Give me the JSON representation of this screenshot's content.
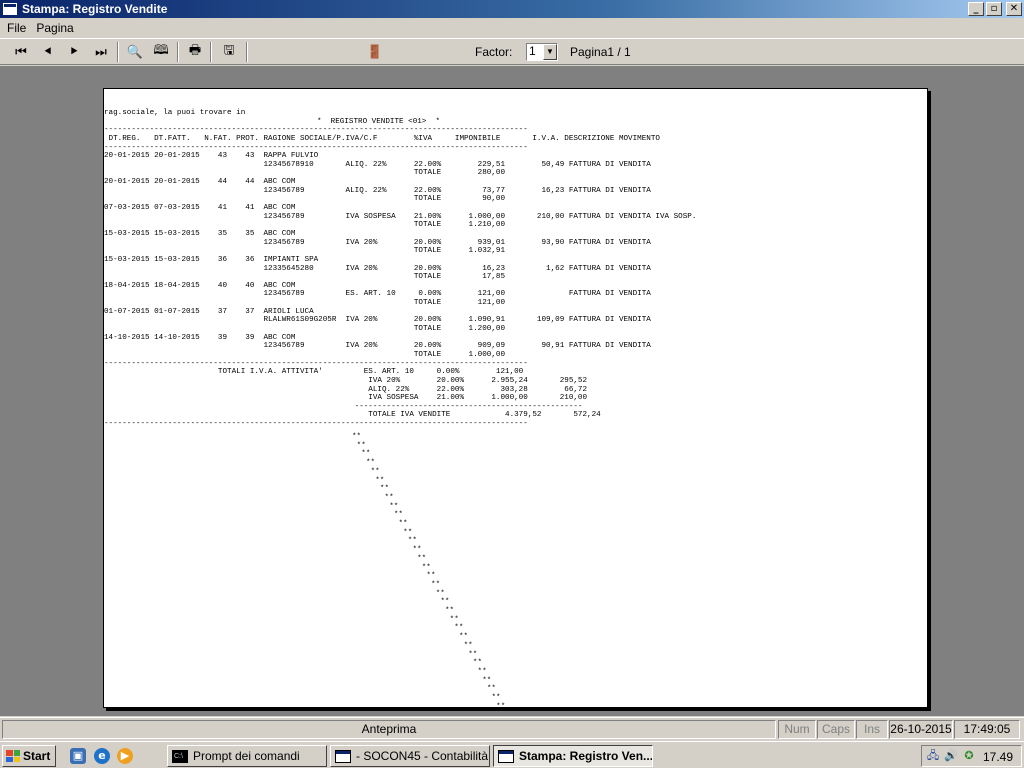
{
  "window": {
    "title": "Stampa: Registro Vendite",
    "buttons": {
      "minimize": "_",
      "maximize": "▫",
      "close": "✕"
    }
  },
  "menu": [
    {
      "label": "File"
    },
    {
      "label": "Pagina"
    }
  ],
  "toolbar": {
    "icons": [
      {
        "name": "first-page-icon",
        "glyph": "⏮"
      },
      {
        "name": "prev-page-icon",
        "glyph": "⯇"
      },
      {
        "name": "next-page-icon",
        "glyph": "⯈"
      },
      {
        "name": "last-page-icon",
        "glyph": "⏭"
      },
      {
        "name": "zoom-icon",
        "glyph": "🔍"
      },
      {
        "name": "two-pages-icon",
        "glyph": "🕮"
      },
      {
        "name": "print-icon",
        "glyph": "🖶"
      },
      {
        "name": "export-icon",
        "glyph": "🖫"
      },
      {
        "name": "exit-icon",
        "glyph": "🚪"
      }
    ],
    "factor_label": "Factor:",
    "factor_value": "1",
    "page_label": "Pagina1 / 1"
  },
  "report": {
    "header_note": "rag.sociale, la puoi trovare in",
    "title": "*  REGISTRO VENDITE <01>  *",
    "separator": "-----------------------------------------------------------------------------------------------------------",
    "short_separator": "---------------------------------------------------------------------------------------------",
    "columns": " DT.REG.   DT.FATT.   N.FAT. PROT. RAGIONE SOCIALE/P.IVA/C.F        %IVA     IMPONIBILE       I.V.A. DESCRIZIONE MOVIMENTO",
    "rows": [
      "20-01-2015 20-01-2015    43    43  RAPPA FULVIO",
      "                                   12345678910       ALIQ. 22%      22.00%        229,51        50,49 FATTURA DI VENDITA",
      "                                                                    TOTALE        280,00",
      "20-01-2015 20-01-2015    44    44  ABC COM",
      "                                   123456789         ALIQ. 22%      22.00%         73,77        16,23 FATTURA DI VENDITA",
      "                                                                    TOTALE         90,00",
      "07-03-2015 07-03-2015    41    41  ABC COM",
      "                                   123456789         IVA SOSPESA    21.00%      1.000,00       210,00 FATTURA DI VENDITA IVA SOSP.",
      "                                                                    TOTALE      1.210,00",
      "15-03-2015 15-03-2015    35    35  ABC COM",
      "                                   123456789         IVA 20%        20.00%        939,01        93,90 FATTURA DI VENDITA",
      "                                                                    TOTALE      1.032,91",
      "15-03-2015 15-03-2015    36    36  IMPIANTI SPA",
      "                                   12335645280       IVA 20%        20.00%         16,23         1,62 FATTURA DI VENDITA",
      "                                                                    TOTALE         17,85",
      "18-04-2015 18-04-2015    40    40  ABC COM",
      "                                   123456789         ES. ART. 10     0.00%        121,00              FATTURA DI VENDITA",
      "                                                                    TOTALE        121,00",
      "01-07-2015 01-07-2015    37    37  ARIOLI LUCA",
      "                                   RLALWR61S09G205R  IVA 20%        20.00%      1.090,91       109,09 FATTURA DI VENDITA",
      "                                                                    TOTALE      1.200,00",
      "14-10-2015 14-10-2015    39    39  ABC COM",
      "                                   123456789         IVA 20%        20.00%        909,09        90,91 FATTURA DI VENDITA",
      "                                                                    TOTALE      1.000,00"
    ],
    "totals": [
      "                         TOTALI I.V.A. ATTIVITA'         ES. ART. 10     0.00%        121,00",
      "                                                          IVA 20%        20.00%      2.955,24       295,52",
      "                                                          ALIQ. 22%      22.00%        303,28        66,72",
      "                                                          IVA SOSPESA    21.00%      1.000,00       210,00"
    ],
    "totals_separator": "                                                       --------------------------------------------------",
    "grand_total": "                                                          TOTALE IVA VENDITE            4.379,52       572,24",
    "star_mark": "**"
  },
  "status": {
    "main": "Anteprima",
    "num": "Num",
    "caps": "Caps",
    "ins": "Ins",
    "date": "26-10-2015",
    "time": "17:49:05"
  },
  "taskbar": {
    "start": "Start",
    "tasks": [
      {
        "label": "Prompt dei comandi",
        "icon": "C:\\"
      },
      {
        "label": "- SOCON45 - Contabilità ...",
        "icon": ""
      },
      {
        "label": "Stampa: Registro Ven...",
        "icon": ""
      }
    ],
    "clock": "17.49"
  }
}
